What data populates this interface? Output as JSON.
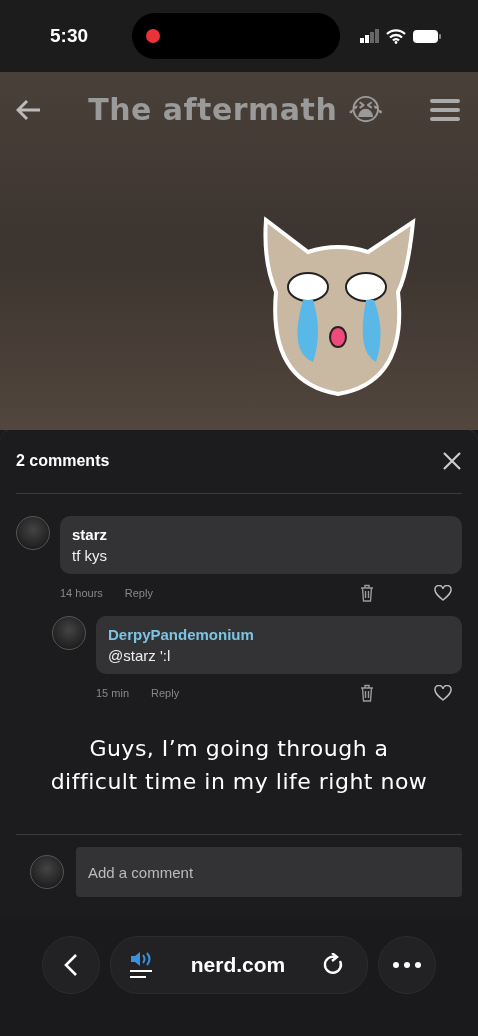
{
  "status_bar": {
    "time": "5:30",
    "recording": true
  },
  "post": {
    "title": "The aftermath 😭"
  },
  "comments_sheet": {
    "title": "2 comments",
    "comments": [
      {
        "author": "starz",
        "text": "tf kys",
        "time": "14 hours",
        "reply_label": "Reply",
        "color": "#ffffff",
        "children": [
          {
            "author": "DerpyPandemonium",
            "text": "@starz  ':l",
            "time": "15 min",
            "reply_label": "Reply",
            "color": "#7cc4e4"
          }
        ]
      }
    ],
    "caption_lines": [
      "Guys, I’m going through a",
      "difficult time in my life right now"
    ],
    "input": {
      "placeholder": "Add a comment"
    }
  },
  "browser_bar": {
    "domain": "nerd.com"
  }
}
